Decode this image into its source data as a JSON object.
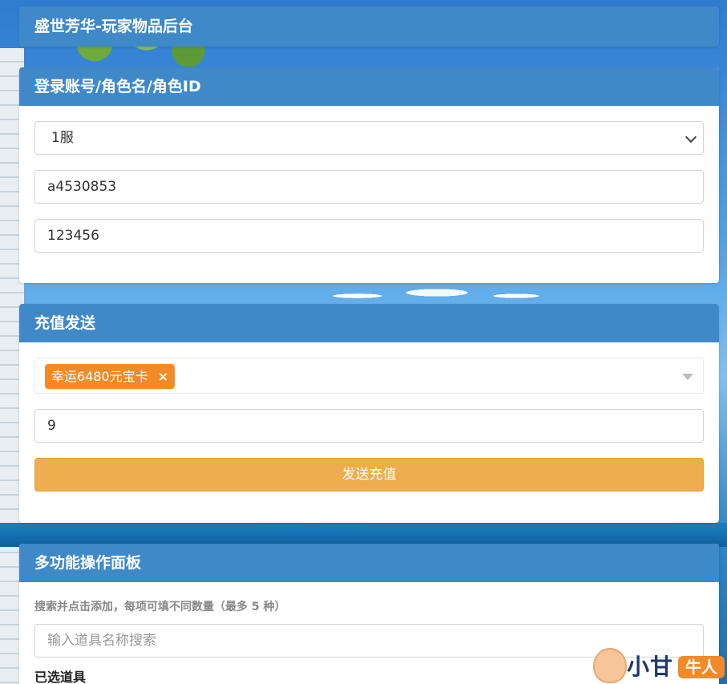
{
  "header": {
    "title": "盛世芳华-玩家物品后台"
  },
  "login": {
    "title": "登录账号/角色名/角色ID",
    "server_selected": "1服",
    "account_value": "a4530853",
    "role_value": "123456"
  },
  "recharge": {
    "title": "充值发送",
    "selected_item": "幸运6480元宝卡",
    "remove_glyph": "×",
    "quantity_value": "9",
    "send_label": "发送充值"
  },
  "multi": {
    "title": "多功能操作面板",
    "hint": "搜索并点击添加，每项可填不同数量（最多 5 种）",
    "search_placeholder": "输入道具名称搜索",
    "selected_label": "已选道具"
  },
  "watermark": {
    "text": "小甘",
    "badge": "牛人"
  },
  "colors": {
    "panel_header": "#3f89c9",
    "tag": "#f18b2a",
    "send_button": "#f0ad4e"
  },
  "icons": {
    "select_arrow": "chevron-down-icon",
    "tag_dropdown": "caret-down-icon",
    "tag_remove": "close-icon"
  }
}
